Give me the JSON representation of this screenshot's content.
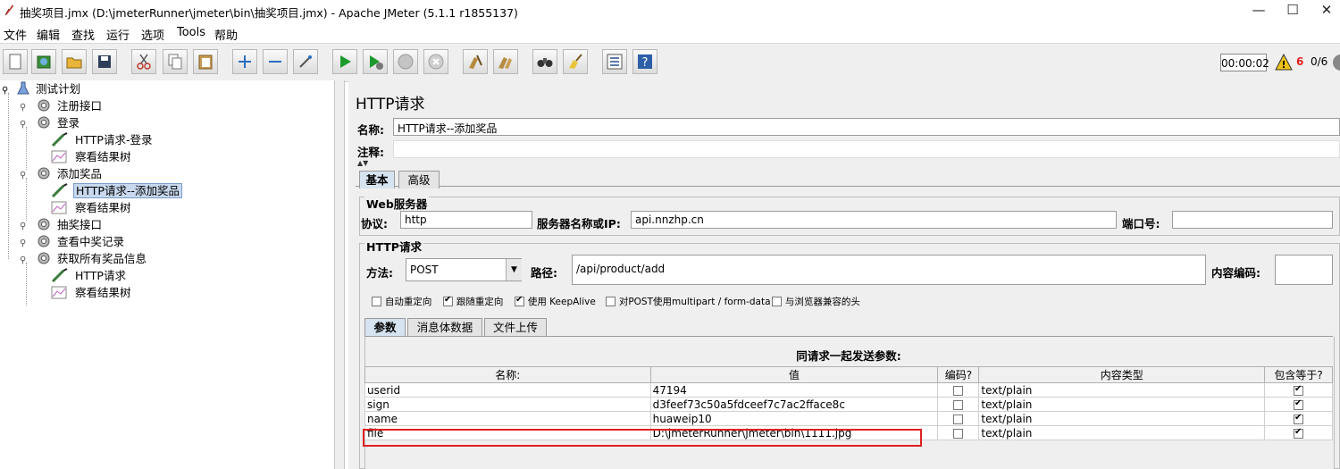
{
  "window": {
    "title": "抽奖项目.jmx (D:\\jmeterRunner\\jmeter\\bin\\抽奖项目.jmx) - Apache JMeter (5.1.1 r1855137)",
    "minimize": "—",
    "maximize": "☐",
    "close": "✕"
  },
  "menu": [
    "文件",
    "编辑",
    "查找",
    "运行",
    "选项",
    "Tools",
    "帮助"
  ],
  "status": {
    "timer": "00:00:02",
    "warnings": "6",
    "threads": "0/6"
  },
  "tree": {
    "root": "测试计划",
    "items": [
      {
        "label": "注册接口"
      },
      {
        "label": "登录"
      },
      {
        "label": "HTTP请求-登录"
      },
      {
        "label": "察看结果树"
      },
      {
        "label": "添加奖品"
      },
      {
        "label": "HTTP请求--添加奖品"
      },
      {
        "label": "察看结果树"
      },
      {
        "label": "抽奖接口"
      },
      {
        "label": "查看中奖记录"
      },
      {
        "label": "获取所有奖品信息"
      },
      {
        "label": "HTTP请求"
      },
      {
        "label": "察看结果树"
      }
    ]
  },
  "panel": {
    "heading": "HTTP请求",
    "name_label": "名称:",
    "name_value": "HTTP请求--添加奖品",
    "comment_label": "注释:",
    "tabs": [
      "基本",
      "高级"
    ],
    "web_server_title": "Web服务器",
    "protocol_label": "协议:",
    "protocol_value": "http",
    "server_label": "服务器名称或IP:",
    "server_value": "api.nnzhp.cn",
    "port_label": "端口号:",
    "port_value": "",
    "http_request_title": "HTTP请求",
    "method_label": "方法:",
    "method_value": "POST",
    "path_label": "路径:",
    "path_value": "/api/product/add",
    "encoding_label": "内容编码:",
    "checkboxes": [
      {
        "label": "自动重定向",
        "checked": false
      },
      {
        "label": "跟随重定向",
        "checked": true
      },
      {
        "label": "使用 KeepAlive",
        "checked": true
      },
      {
        "label": "对POST使用multipart / form-data",
        "checked": false
      },
      {
        "label": "与浏览器兼容的头",
        "checked": false
      }
    ],
    "subtabs": [
      "参数",
      "消息体数据",
      "文件上传"
    ],
    "params_title": "同请求一起发送参数:",
    "columns": [
      "名称:",
      "值",
      "编码?",
      "内容类型",
      "包含等于?"
    ],
    "rows": [
      {
        "name": "userid",
        "value": "47194",
        "encode": false,
        "content_type": "text/plain",
        "include_equals": true
      },
      {
        "name": "sign",
        "value": "d3feef73c50a5fdceef7c7ac2fface8c",
        "encode": false,
        "content_type": "text/plain",
        "include_equals": true
      },
      {
        "name": "name",
        "value": "huaweip10",
        "encode": false,
        "content_type": "text/plain",
        "include_equals": true
      },
      {
        "name": "file",
        "value": "D:\\jmeterRunner\\jmeter\\bin\\1111.jpg",
        "encode": false,
        "content_type": "text/plain",
        "include_equals": true
      }
    ],
    "highlight_color": "#e02020"
  }
}
